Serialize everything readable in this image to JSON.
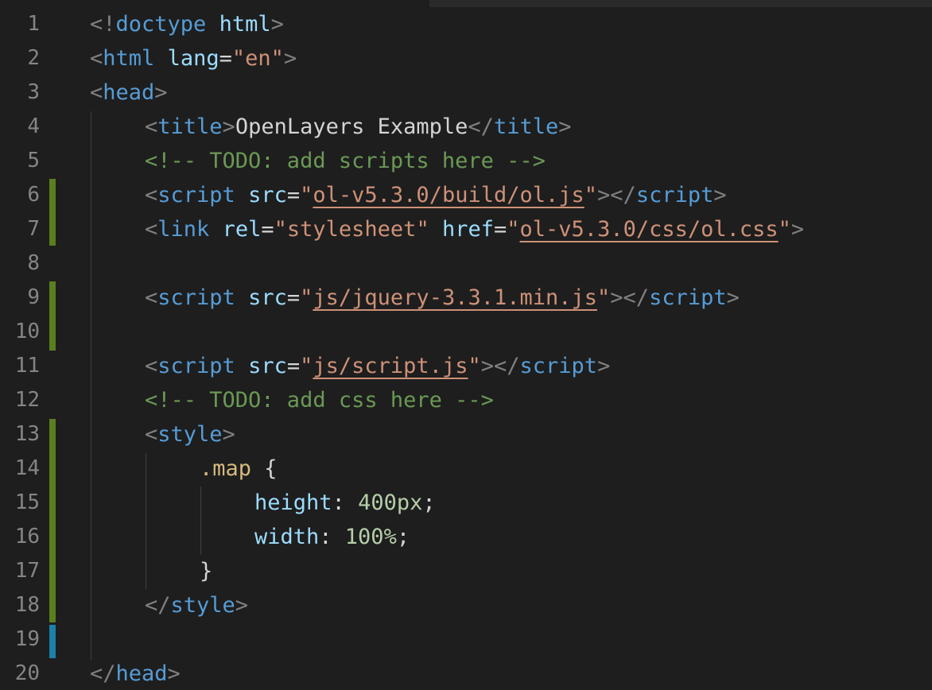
{
  "line_numbers": [
    "1",
    "2",
    "3",
    "4",
    "5",
    "6",
    "7",
    "8",
    "9",
    "10",
    "11",
    "12",
    "13",
    "14",
    "15",
    "16",
    "17",
    "18",
    "19",
    "20"
  ],
  "code": {
    "l1": {
      "open": "<!",
      "tag": "doctype",
      "sp": " ",
      "text": "html",
      "close": ">"
    },
    "l2": {
      "open": "<",
      "tag": "html",
      "sp": " ",
      "attr": "lang",
      "eq": "=",
      "q1": "\"",
      "val": "en",
      "q2": "\"",
      "close": ">"
    },
    "l3": {
      "open": "<",
      "tag": "head",
      "close": ">"
    },
    "l4": {
      "open": "<",
      "tag": "title",
      "close": ">",
      "text": "OpenLayers Example",
      "open2": "</",
      "tag2": "title",
      "close2": ">"
    },
    "l5": {
      "comment": "<!-- TODO: add scripts here -->"
    },
    "l6": {
      "open": "<",
      "tag": "script",
      "sp": " ",
      "attr": "src",
      "eq": "=",
      "q1": "\"",
      "val": "ol-v5.3.0/build/ol.js",
      "q2": "\"",
      "close": ">",
      "open2": "</",
      "tag2": "script",
      "close2": ">"
    },
    "l7": {
      "open": "<",
      "tag": "link",
      "sp": " ",
      "attr": "rel",
      "eq": "=",
      "q1": "\"",
      "val": "stylesheet",
      "q2": "\"",
      "sp2": " ",
      "attr2": "href",
      "eq2": "=",
      "q3": "\"",
      "val2": "ol-v5.3.0/css/ol.css",
      "q4": "\"",
      "close": ">"
    },
    "l9": {
      "open": "<",
      "tag": "script",
      "sp": " ",
      "attr": "src",
      "eq": "=",
      "q1": "\"",
      "val": "js/jquery-3.3.1.min.js",
      "q2": "\"",
      "close": ">",
      "open2": "</",
      "tag2": "script",
      "close2": ">"
    },
    "l11": {
      "open": "<",
      "tag": "script",
      "sp": " ",
      "attr": "src",
      "eq": "=",
      "q1": "\"",
      "val": "js/script.js",
      "q2": "\"",
      "close": ">",
      "open2": "</",
      "tag2": "script",
      "close2": ">"
    },
    "l12": {
      "comment": "<!-- TODO: add css here -->"
    },
    "l13": {
      "open": "<",
      "tag": "style",
      "close": ">"
    },
    "l14": {
      "selector": ".map",
      "sp": " ",
      "brace": "{"
    },
    "l15": {
      "prop": "height",
      "colon": ": ",
      "num": "400px",
      "semi": ";"
    },
    "l16": {
      "prop": "width",
      "colon": ": ",
      "num": "100%",
      "semi": ";"
    },
    "l17": {
      "brace": "}"
    },
    "l18": {
      "open": "</",
      "tag": "style",
      "close": ">"
    },
    "l20": {
      "open": "</",
      "tag": "head",
      "close": ">"
    }
  },
  "colors": {
    "background": "#1e1e1e",
    "line_number": "#858585",
    "tag": "#569cd6",
    "attribute": "#9cdcfe",
    "string": "#ce9178",
    "comment": "#6a9955",
    "selector": "#d7ba7d",
    "number": "#b5cea8",
    "gutter_modified": "#5a7f1e",
    "gutter_added": "#1b81a8"
  }
}
